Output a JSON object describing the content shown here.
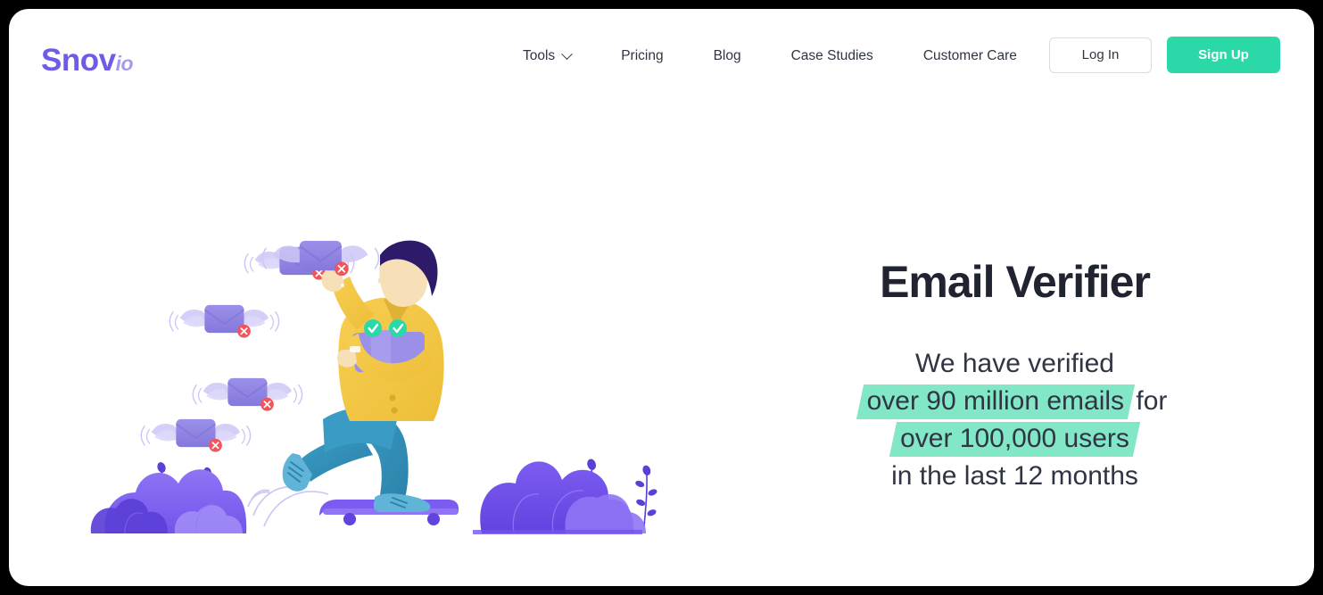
{
  "brand": {
    "name": "Snov",
    "suffix": "io",
    "primary_color": "#6c5ce7",
    "suffix_color": "#a29bf0"
  },
  "header": {
    "nav": [
      {
        "label": "Tools",
        "icon": "chevron-down-icon",
        "has_dropdown": true
      },
      {
        "label": "Pricing",
        "has_dropdown": false
      },
      {
        "label": "Blog",
        "has_dropdown": false
      },
      {
        "label": "Case Studies",
        "has_dropdown": false
      },
      {
        "label": "Customer Care",
        "has_dropdown": false
      }
    ],
    "login_label": "Log In",
    "signup_label": "Sign Up",
    "signup_color": "#2bd9a8"
  },
  "hero": {
    "title": "Email Verifier",
    "subtitle_lines": [
      {
        "pre": "We have verified",
        "highlight": "",
        "post": ""
      },
      {
        "pre": "",
        "highlight": "over 90 million emails",
        "post": " for"
      },
      {
        "pre": "",
        "highlight": "over 100,000 users",
        "post": ""
      },
      {
        "pre": "in the last 12 months",
        "highlight": "",
        "post": ""
      }
    ],
    "highlight_color": "#82e7c7",
    "illustration": {
      "name": "email-verifier-illustration",
      "description": "Person on a skateboard releasing invalid winged envelopes marked with red X badges while carrying verified envelopes marked with green checkmarks, with purple bushes on the ground",
      "invalid_envelopes": 4,
      "invalid_badge_icon": "red-x-icon",
      "valid_badge_icon": "green-check-icon",
      "colors": {
        "envelope": "#8a7fe0",
        "wing": "#cdc7f5",
        "invalid_badge": "#f2545b",
        "valid_badge": "#2bd9a8",
        "jacket": "#f5c842",
        "pants": "#2f8fb5",
        "hair": "#2d1b69",
        "skin": "#f7e0b8",
        "board": "#7c5cf0",
        "bush": "#6c4ff0"
      }
    }
  }
}
